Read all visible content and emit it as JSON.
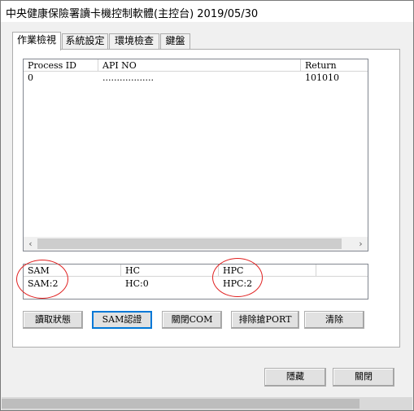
{
  "window": {
    "title": "中央健康保險署讀卡機控制軟體(主控台) 2019/05/30"
  },
  "tabs": [
    {
      "label": "作業檢視",
      "active": true
    },
    {
      "label": "系統設定",
      "active": false
    },
    {
      "label": "環境檢查",
      "active": false
    },
    {
      "label": "鍵盤",
      "active": false
    }
  ],
  "process_list": {
    "columns": [
      "Process ID",
      "API NO",
      "Return"
    ],
    "rows": [
      {
        "process_id": "0",
        "api_no": "..................",
        "return": "101010"
      }
    ]
  },
  "scrollbar": {
    "left_arrow": "‹",
    "right_arrow": "›"
  },
  "status_grid": {
    "columns": [
      "SAM",
      "HC",
      "HPC",
      ""
    ],
    "values": [
      "SAM:2",
      "HC:0",
      "HPC:2",
      ""
    ]
  },
  "buttons": {
    "read_status": "讀取狀態",
    "sam_auth": "SAM認證",
    "close_com": "關閉COM",
    "remove_port": "排除搶PORT",
    "clear": "清除",
    "hide": "隱藏",
    "close": "關閉"
  },
  "colors": {
    "annotation_circle": "#e02020",
    "focus_border": "#0078d7"
  }
}
